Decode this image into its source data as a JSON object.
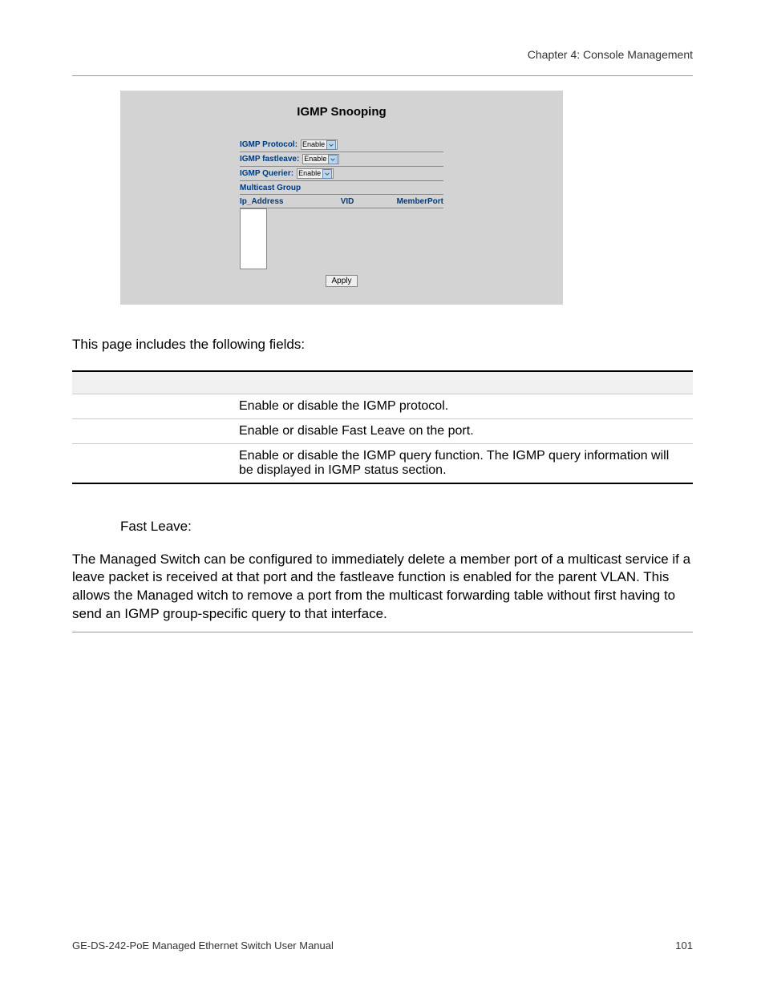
{
  "header": {
    "chapter": "Chapter 4: Console Management"
  },
  "ui": {
    "title": "IGMP Snooping",
    "rows": {
      "protocol": {
        "label": "IGMP Protocol:",
        "value": "Enable"
      },
      "fastleave": {
        "label": "IGMP fastleave:",
        "value": "Enable"
      },
      "querier": {
        "label": "IGMP Querier:",
        "value": "Enable"
      }
    },
    "group_label": "Multicast Group",
    "cols": {
      "ip": "Ip_Address",
      "vid": "VID",
      "member": "MemberPort"
    },
    "apply": "Apply"
  },
  "intro": "This page includes the following fields:",
  "table": {
    "rows": [
      {
        "label": "",
        "desc": "Enable or disable the IGMP protocol."
      },
      {
        "label": "",
        "desc": "Enable or disable Fast Leave on the port."
      },
      {
        "label": "",
        "desc": "Enable or disable the IGMP query function. The IGMP query information will be displayed in IGMP status section."
      }
    ]
  },
  "subhead": "Fast Leave:",
  "para": "The Managed Switch can be configured to immediately delete a member port of a multicast service if a leave packet is received at that port and the fastleave function is enabled for the parent VLAN. This allows the Managed witch to remove a port from the multicast forwarding table without first having to send an IGMP group-specific query to that interface.",
  "footer": {
    "left": "GE-DS-242-PoE Managed Ethernet Switch User Manual",
    "right": "101"
  }
}
